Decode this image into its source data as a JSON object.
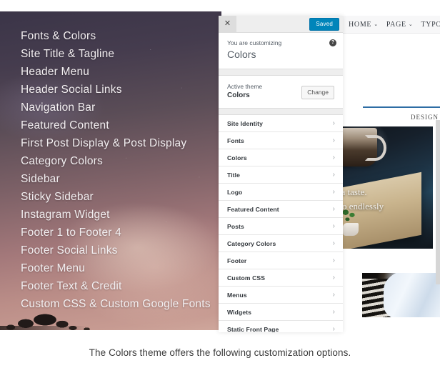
{
  "hero": {
    "options": [
      "Fonts & Colors",
      "Site Title & Tagline",
      "Header Menu",
      "Header Social Links",
      "Navigation Bar",
      "Featured Content",
      "First Post Display & Post Display",
      "Category Colors",
      "Sidebar",
      "Sticky Sidebar",
      "Instagram Widget",
      "Footer 1 to Footer 4",
      "Footer Social Links",
      "Footer Menu",
      "Footer Text & Credit",
      "Custom CSS & Custom Google Fonts"
    ]
  },
  "customizer": {
    "close_label": "✕",
    "close_icon": "close-icon",
    "save_label": "Saved",
    "kicker": "You are customizing",
    "title": "Colors",
    "help_label": "?",
    "help_icon": "help-icon",
    "active_theme_label": "Active theme",
    "active_theme_name": "Colors",
    "change_label": "Change",
    "chevron": "›",
    "menu": [
      "Site Identity",
      "Fonts",
      "Colors",
      "Title",
      "Logo",
      "Featured Content",
      "Posts",
      "Category Colors",
      "Footer",
      "Custom CSS",
      "Menus",
      "Widgets",
      "Static Front Page"
    ]
  },
  "preview": {
    "nav": [
      {
        "label": "HOME",
        "caret": "⌄"
      },
      {
        "label": "PAGE",
        "caret": "⌄"
      },
      {
        "label": "TYPOG",
        "caret": ""
      }
    ],
    "design_label": "DESIGN",
    "hero_quote_line1": "ke a taste.",
    "hero_quote_line2": "is so endlessly"
  },
  "caption": "The Colors theme offers the following customization options.",
  "colors": {
    "accent_blue": "#0085ba",
    "underline_blue": "#2e6da4",
    "panel_bg": "#ffffff",
    "panel_chrome": "#eeeeee",
    "text_dark": "#32373c",
    "text_muted": "#555d66"
  }
}
